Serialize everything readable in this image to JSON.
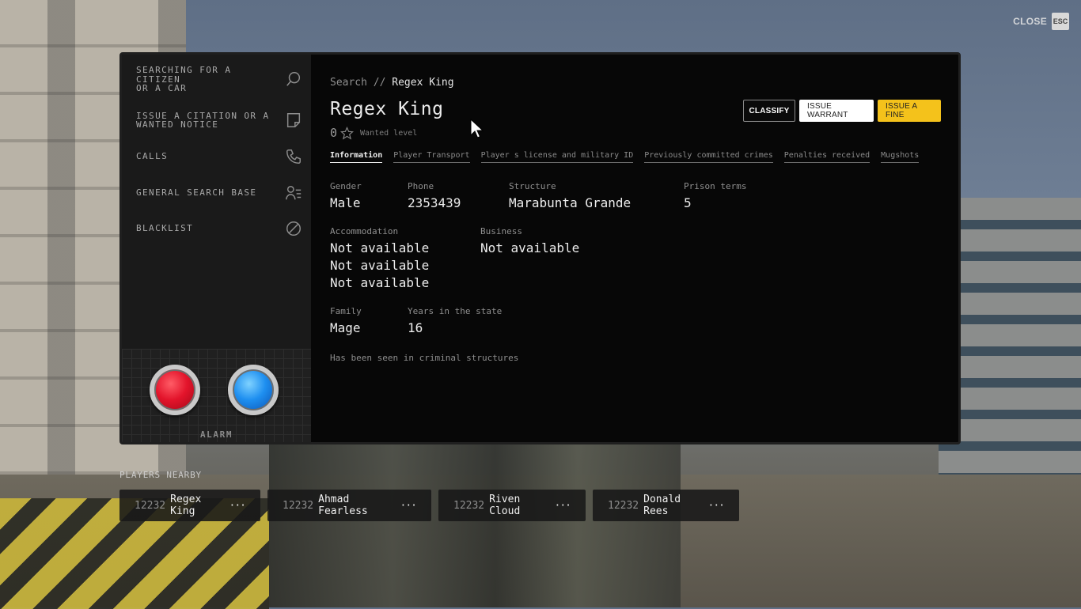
{
  "close": {
    "label": "CLOSE",
    "key": "ESC"
  },
  "sidebar": {
    "items": [
      {
        "label": "SEARCHING FOR A CITIZEN\nOR A CAR",
        "icon": "search-icon"
      },
      {
        "label": "ISSUE A CITATION OR A WANTED NOTICE",
        "icon": "note-icon"
      },
      {
        "label": "CALLS",
        "icon": "phone-icon"
      },
      {
        "label": "GENERAL SEARCH BASE",
        "icon": "people-list-icon"
      },
      {
        "label": "BLACKLIST",
        "icon": "block-icon"
      }
    ],
    "alarm_label": "ALARM"
  },
  "breadcrumb": {
    "root": "Search",
    "separator": "//",
    "current": "Regex King"
  },
  "citizen": {
    "name": "Regex King",
    "wanted_count": "0",
    "wanted_label": "Wanted level"
  },
  "actions": {
    "classify": "CLASSIFY",
    "warrant": "ISSUE WARRANT",
    "fine": "ISSUE A FINE"
  },
  "tabs": [
    {
      "label": "Information",
      "active": true
    },
    {
      "label": "Player Transport",
      "active": false
    },
    {
      "label": "Player s license and military ID",
      "active": false
    },
    {
      "label": "Previously committed crimes",
      "active": false
    },
    {
      "label": "Penalties received",
      "active": false
    },
    {
      "label": "Mugshots",
      "active": false
    }
  ],
  "info": {
    "gender": {
      "label": "Gender",
      "value": "Male"
    },
    "phone": {
      "label": "Phone",
      "value": "2353439"
    },
    "structure": {
      "label": "Structure",
      "value": "Marabunta Grande"
    },
    "prison": {
      "label": "Prison terms",
      "value": "5"
    },
    "accommodation": {
      "label": "Accommodation",
      "values": [
        "Not available",
        "Not available",
        "Not available"
      ]
    },
    "business": {
      "label": "Business",
      "value": "Not available"
    },
    "family": {
      "label": "Family",
      "value": "Mage"
    },
    "years": {
      "label": "Years in the state",
      "value": "16"
    },
    "seen_note": "Has been seen in criminal structures"
  },
  "nearby": {
    "title": "PLAYERS NEARBY",
    "players": [
      {
        "id": "12232",
        "name": "Regex King",
        "more": "···"
      },
      {
        "id": "12232",
        "name": "Ahmad Fearless",
        "more": "···"
      },
      {
        "id": "12232",
        "name": "Riven Cloud",
        "more": "···"
      },
      {
        "id": "12232",
        "name": "Donald Rees",
        "more": "···"
      }
    ]
  },
  "colors": {
    "accent_yellow": "#f4c21b",
    "alarm_red": "#e3142b",
    "alarm_blue": "#1e8ff0"
  }
}
